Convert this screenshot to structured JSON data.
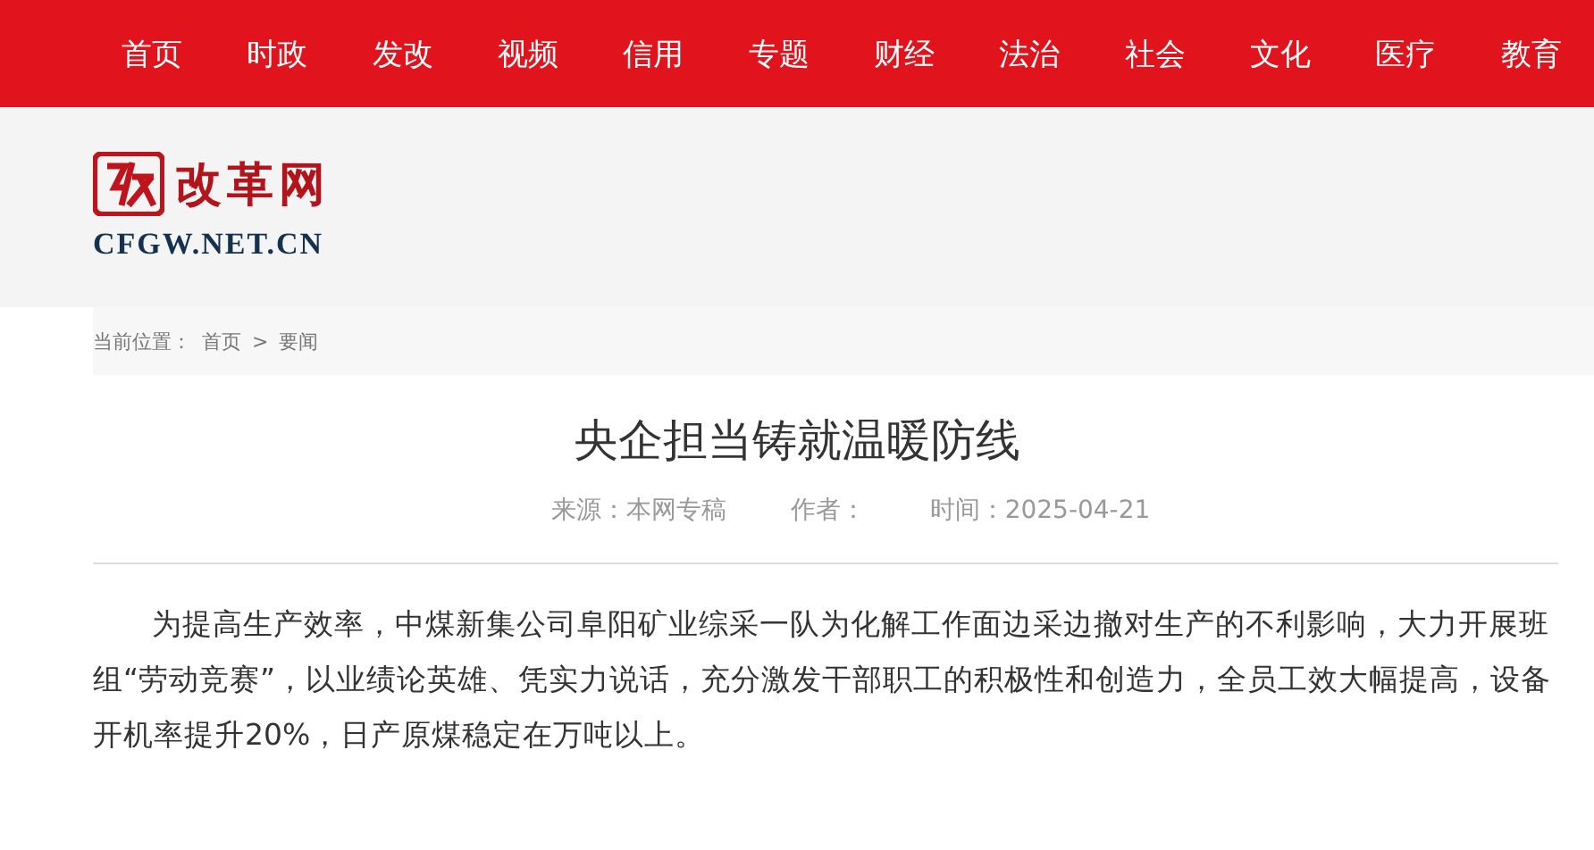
{
  "nav": [
    {
      "label": "首页"
    },
    {
      "label": "时政"
    },
    {
      "label": "发改"
    },
    {
      "label": "视频"
    },
    {
      "label": "信用"
    },
    {
      "label": "专题"
    },
    {
      "label": "财经"
    },
    {
      "label": "法治"
    },
    {
      "label": "社会"
    },
    {
      "label": "文化"
    },
    {
      "label": "医疗"
    },
    {
      "label": "教育"
    }
  ],
  "logo": {
    "name": "改革网",
    "domain": "CFGW.NET.CN"
  },
  "breadcrumb": {
    "prefix": "当前位置：",
    "items": [
      "首页",
      "要闻"
    ],
    "separator": ">"
  },
  "article": {
    "title": "央企担当铸就温暖防线",
    "source": "来源：本网专稿",
    "author": "作者：",
    "time": "时间：2025-04-21",
    "paragraphs": [
      "为提高生产效率，中煤新集公司阜阳矿业综采一队为化解工作面边采边撤对生产的不利影响，大力开展班组“劳动竞赛”，以业绩论英雄、凭实力说话，充分激发干部职工的积极性和创造力，全员工效大幅提高，设备开机率提升20%，日产原煤稳定在万吨以上。"
    ]
  }
}
